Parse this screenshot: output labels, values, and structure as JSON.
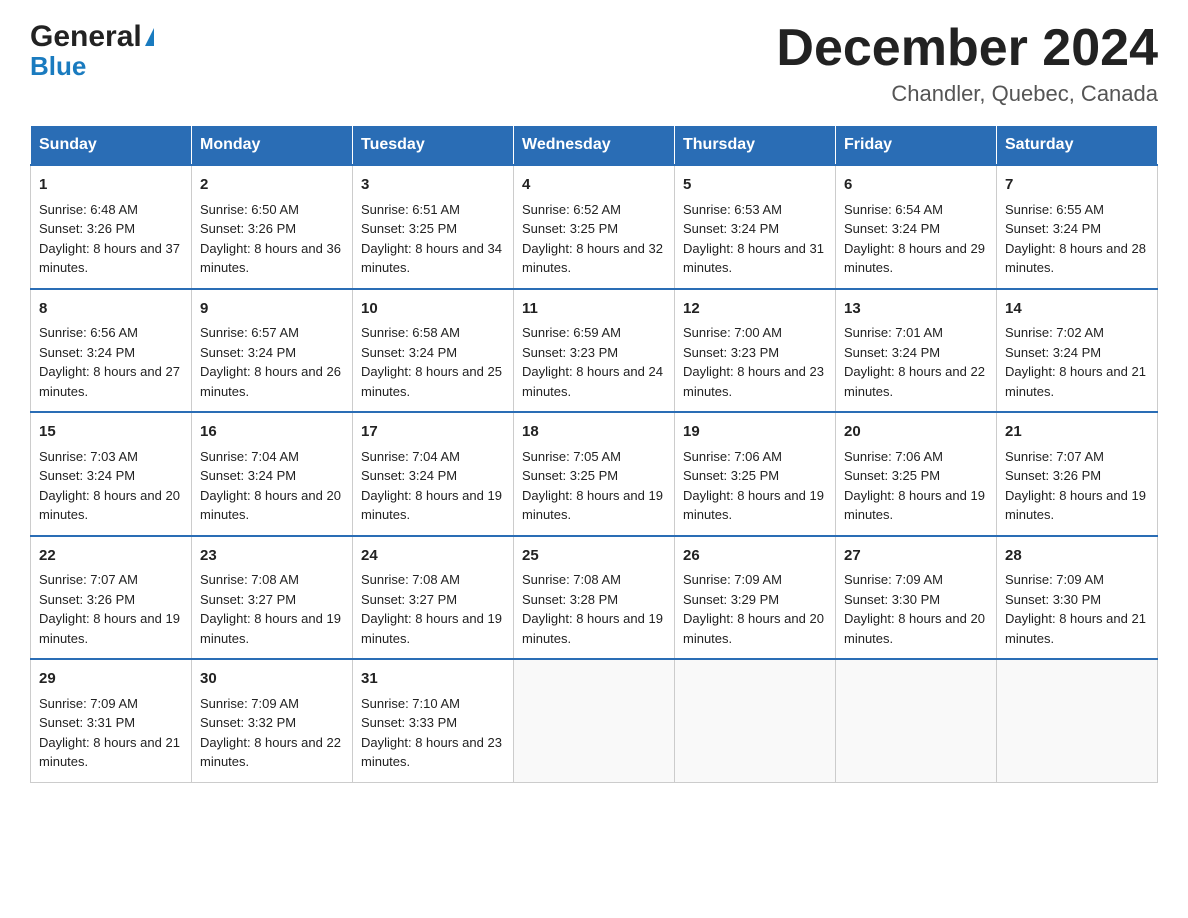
{
  "header": {
    "logo_general": "General",
    "logo_blue": "Blue",
    "month_title": "December 2024",
    "location": "Chandler, Quebec, Canada"
  },
  "days_of_week": [
    "Sunday",
    "Monday",
    "Tuesday",
    "Wednesday",
    "Thursday",
    "Friday",
    "Saturday"
  ],
  "weeks": [
    [
      {
        "day": "1",
        "sunrise": "6:48 AM",
        "sunset": "3:26 PM",
        "daylight": "8 hours and 37 minutes."
      },
      {
        "day": "2",
        "sunrise": "6:50 AM",
        "sunset": "3:26 PM",
        "daylight": "8 hours and 36 minutes."
      },
      {
        "day": "3",
        "sunrise": "6:51 AM",
        "sunset": "3:25 PM",
        "daylight": "8 hours and 34 minutes."
      },
      {
        "day": "4",
        "sunrise": "6:52 AM",
        "sunset": "3:25 PM",
        "daylight": "8 hours and 32 minutes."
      },
      {
        "day": "5",
        "sunrise": "6:53 AM",
        "sunset": "3:24 PM",
        "daylight": "8 hours and 31 minutes."
      },
      {
        "day": "6",
        "sunrise": "6:54 AM",
        "sunset": "3:24 PM",
        "daylight": "8 hours and 29 minutes."
      },
      {
        "day": "7",
        "sunrise": "6:55 AM",
        "sunset": "3:24 PM",
        "daylight": "8 hours and 28 minutes."
      }
    ],
    [
      {
        "day": "8",
        "sunrise": "6:56 AM",
        "sunset": "3:24 PM",
        "daylight": "8 hours and 27 minutes."
      },
      {
        "day": "9",
        "sunrise": "6:57 AM",
        "sunset": "3:24 PM",
        "daylight": "8 hours and 26 minutes."
      },
      {
        "day": "10",
        "sunrise": "6:58 AM",
        "sunset": "3:24 PM",
        "daylight": "8 hours and 25 minutes."
      },
      {
        "day": "11",
        "sunrise": "6:59 AM",
        "sunset": "3:23 PM",
        "daylight": "8 hours and 24 minutes."
      },
      {
        "day": "12",
        "sunrise": "7:00 AM",
        "sunset": "3:23 PM",
        "daylight": "8 hours and 23 minutes."
      },
      {
        "day": "13",
        "sunrise": "7:01 AM",
        "sunset": "3:24 PM",
        "daylight": "8 hours and 22 minutes."
      },
      {
        "day": "14",
        "sunrise": "7:02 AM",
        "sunset": "3:24 PM",
        "daylight": "8 hours and 21 minutes."
      }
    ],
    [
      {
        "day": "15",
        "sunrise": "7:03 AM",
        "sunset": "3:24 PM",
        "daylight": "8 hours and 20 minutes."
      },
      {
        "day": "16",
        "sunrise": "7:04 AM",
        "sunset": "3:24 PM",
        "daylight": "8 hours and 20 minutes."
      },
      {
        "day": "17",
        "sunrise": "7:04 AM",
        "sunset": "3:24 PM",
        "daylight": "8 hours and 19 minutes."
      },
      {
        "day": "18",
        "sunrise": "7:05 AM",
        "sunset": "3:25 PM",
        "daylight": "8 hours and 19 minutes."
      },
      {
        "day": "19",
        "sunrise": "7:06 AM",
        "sunset": "3:25 PM",
        "daylight": "8 hours and 19 minutes."
      },
      {
        "day": "20",
        "sunrise": "7:06 AM",
        "sunset": "3:25 PM",
        "daylight": "8 hours and 19 minutes."
      },
      {
        "day": "21",
        "sunrise": "7:07 AM",
        "sunset": "3:26 PM",
        "daylight": "8 hours and 19 minutes."
      }
    ],
    [
      {
        "day": "22",
        "sunrise": "7:07 AM",
        "sunset": "3:26 PM",
        "daylight": "8 hours and 19 minutes."
      },
      {
        "day": "23",
        "sunrise": "7:08 AM",
        "sunset": "3:27 PM",
        "daylight": "8 hours and 19 minutes."
      },
      {
        "day": "24",
        "sunrise": "7:08 AM",
        "sunset": "3:27 PM",
        "daylight": "8 hours and 19 minutes."
      },
      {
        "day": "25",
        "sunrise": "7:08 AM",
        "sunset": "3:28 PM",
        "daylight": "8 hours and 19 minutes."
      },
      {
        "day": "26",
        "sunrise": "7:09 AM",
        "sunset": "3:29 PM",
        "daylight": "8 hours and 20 minutes."
      },
      {
        "day": "27",
        "sunrise": "7:09 AM",
        "sunset": "3:30 PM",
        "daylight": "8 hours and 20 minutes."
      },
      {
        "day": "28",
        "sunrise": "7:09 AM",
        "sunset": "3:30 PM",
        "daylight": "8 hours and 21 minutes."
      }
    ],
    [
      {
        "day": "29",
        "sunrise": "7:09 AM",
        "sunset": "3:31 PM",
        "daylight": "8 hours and 21 minutes."
      },
      {
        "day": "30",
        "sunrise": "7:09 AM",
        "sunset": "3:32 PM",
        "daylight": "8 hours and 22 minutes."
      },
      {
        "day": "31",
        "sunrise": "7:10 AM",
        "sunset": "3:33 PM",
        "daylight": "8 hours and 23 minutes."
      },
      null,
      null,
      null,
      null
    ]
  ]
}
